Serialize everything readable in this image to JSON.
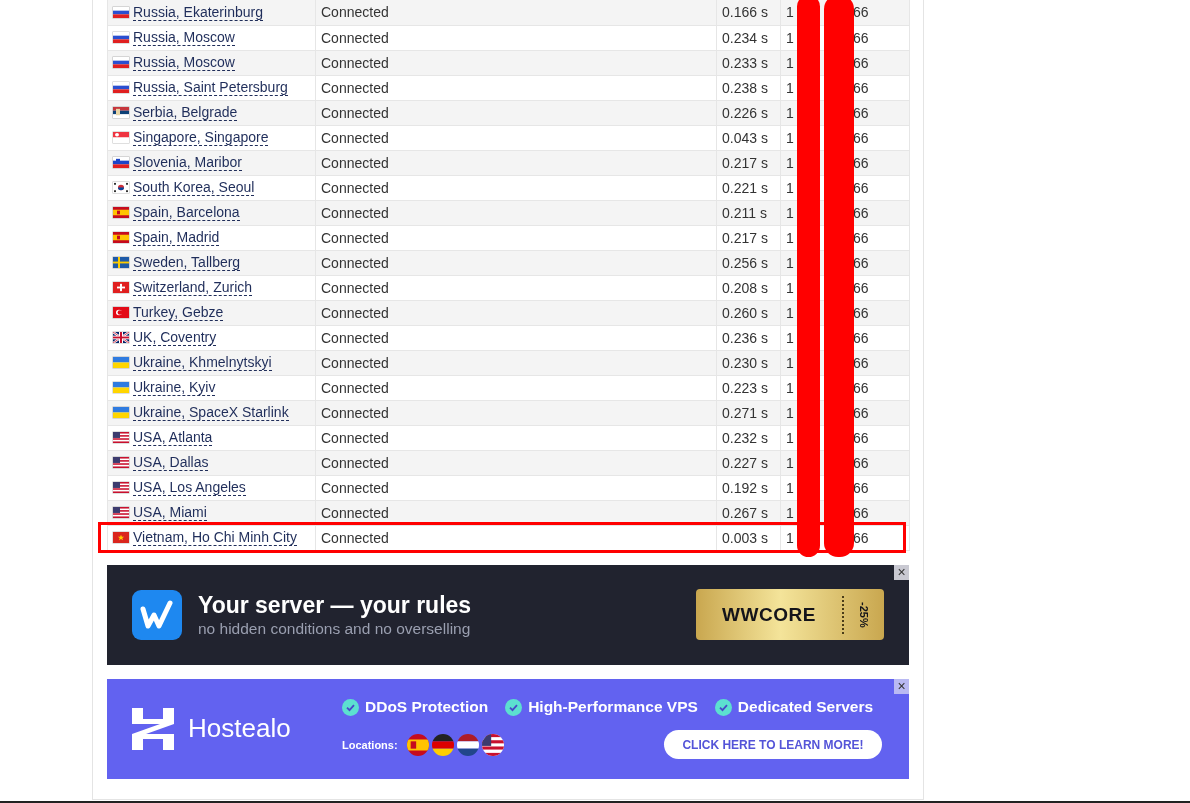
{
  "table": {
    "ip_redacted": true,
    "rows": [
      {
        "kind": "ru",
        "location": "Russia, Ekaterinburg",
        "status": "Connected",
        "time": "0.166 s",
        "ip_start": "1",
        "ip_end": "66",
        "highlighted": false
      },
      {
        "kind": "ru",
        "location": "Russia, Moscow",
        "status": "Connected",
        "time": "0.234 s",
        "ip_start": "1",
        "ip_end": "66",
        "highlighted": false
      },
      {
        "kind": "ru",
        "location": "Russia, Moscow",
        "status": "Connected",
        "time": "0.233 s",
        "ip_start": "1",
        "ip_end": "66",
        "highlighted": false
      },
      {
        "kind": "ru",
        "location": "Russia, Saint Petersburg",
        "status": "Connected",
        "time": "0.238 s",
        "ip_start": "1",
        "ip_end": "66",
        "highlighted": false
      },
      {
        "kind": "rs",
        "location": "Serbia, Belgrade",
        "status": "Connected",
        "time": "0.226 s",
        "ip_start": "1",
        "ip_end": "66",
        "highlighted": false
      },
      {
        "kind": "sg",
        "location": "Singapore, Singapore",
        "status": "Connected",
        "time": "0.043 s",
        "ip_start": "1",
        "ip_end": "66",
        "highlighted": false
      },
      {
        "kind": "si",
        "location": "Slovenia, Maribor",
        "status": "Connected",
        "time": "0.217 s",
        "ip_start": "1",
        "ip_end": "66",
        "highlighted": false
      },
      {
        "kind": "kr",
        "location": "South Korea, Seoul",
        "status": "Connected",
        "time": "0.221 s",
        "ip_start": "1",
        "ip_end": "66",
        "highlighted": false
      },
      {
        "kind": "es",
        "location": "Spain, Barcelona",
        "status": "Connected",
        "time": "0.211 s",
        "ip_start": "1",
        "ip_end": "66",
        "highlighted": false
      },
      {
        "kind": "es",
        "location": "Spain, Madrid",
        "status": "Connected",
        "time": "0.217 s",
        "ip_start": "1",
        "ip_end": "66",
        "highlighted": false
      },
      {
        "kind": "se",
        "location": "Sweden, Tallberg",
        "status": "Connected",
        "time": "0.256 s",
        "ip_start": "1",
        "ip_end": "66",
        "highlighted": false
      },
      {
        "kind": "ch",
        "location": "Switzerland, Zurich",
        "status": "Connected",
        "time": "0.208 s",
        "ip_start": "1",
        "ip_end": "66",
        "highlighted": false
      },
      {
        "kind": "tr",
        "location": "Turkey, Gebze",
        "status": "Connected",
        "time": "0.260 s",
        "ip_start": "1",
        "ip_end": "66",
        "highlighted": false
      },
      {
        "kind": "gb",
        "location": "UK, Coventry",
        "status": "Connected",
        "time": "0.236 s",
        "ip_start": "1",
        "ip_end": "66",
        "highlighted": false
      },
      {
        "kind": "ua",
        "location": "Ukraine, Khmelnytskyi",
        "status": "Connected",
        "time": "0.230 s",
        "ip_start": "1",
        "ip_end": "66",
        "highlighted": false
      },
      {
        "kind": "ua",
        "location": "Ukraine, Kyiv",
        "status": "Connected",
        "time": "0.223 s",
        "ip_start": "1",
        "ip_end": "66",
        "highlighted": false
      },
      {
        "kind": "ua",
        "location": "Ukraine, SpaceX Starlink",
        "status": "Connected",
        "time": "0.271 s",
        "ip_start": "1",
        "ip_end": "66",
        "highlighted": false
      },
      {
        "kind": "us",
        "location": "USA, Atlanta",
        "status": "Connected",
        "time": "0.232 s",
        "ip_start": "1",
        "ip_end": "66",
        "highlighted": false
      },
      {
        "kind": "us",
        "location": "USA, Dallas",
        "status": "Connected",
        "time": "0.227 s",
        "ip_start": "1",
        "ip_end": "66",
        "highlighted": false
      },
      {
        "kind": "us",
        "location": "USA, Los Angeles",
        "status": "Connected",
        "time": "0.192 s",
        "ip_start": "1",
        "ip_end": "66",
        "highlighted": false
      },
      {
        "kind": "us",
        "location": "USA, Miami",
        "status": "Connected",
        "time": "0.267 s",
        "ip_start": "1",
        "ip_end": "66",
        "highlighted": false
      },
      {
        "kind": "vn",
        "location": "Vietnam, Ho Chi Minh City",
        "status": "Connected",
        "time": "0.003 s",
        "ip_start": "1",
        "ip_end": "66",
        "highlighted": true
      }
    ]
  },
  "ads": [
    {
      "kind": "wwcore",
      "title": "Your server — your rules",
      "subtitle": "no hidden conditions and no overselling",
      "coupon": "WWCORE",
      "discount": "-25%",
      "close": "×"
    },
    {
      "kind": "hostealo",
      "brand": "Hostealo",
      "features": [
        "DDoS Protection",
        "High-Performance VPS",
        "Dedicated Servers"
      ],
      "locations_label": "Locations:",
      "location_flags": [
        {
          "kind": "es"
        },
        {
          "kind": "de"
        },
        {
          "kind": "nl"
        },
        {
          "kind": "us"
        }
      ],
      "button": "CLICK HERE TO LEARN MORE!",
      "close": "×"
    }
  ]
}
